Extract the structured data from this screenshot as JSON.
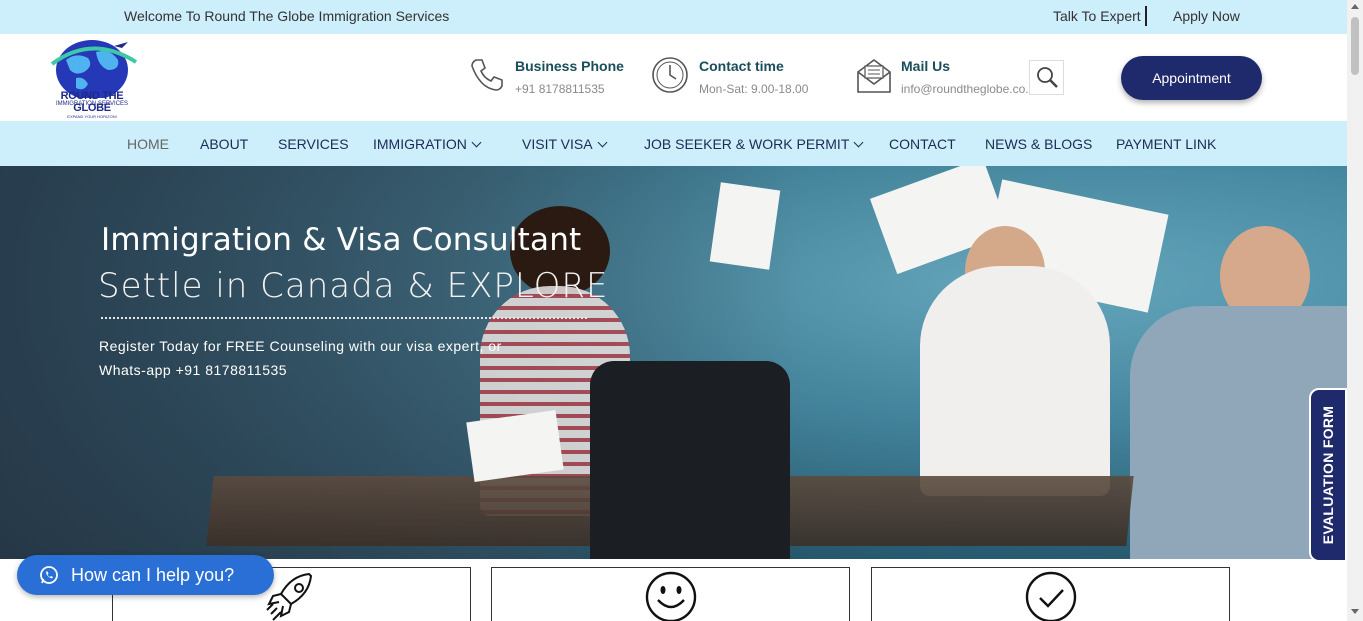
{
  "topbar": {
    "welcome": "Welcome To Round The Globe Immigration Services",
    "talk": "Talk To Expert",
    "apply": "Apply Now"
  },
  "logo": {
    "brand": "ROUND THE GLOBE",
    "sub": "IMMIGRATION SERVICES",
    "tagline": "EXPAND YOUR HORIZON!"
  },
  "header": {
    "phone_title": "Business Phone",
    "phone_value": "+91 8178811535",
    "time_title": "Contact time",
    "time_value": "Mon-Sat: 9.00-18.00",
    "mail_title": "Mail Us",
    "mail_value": "info@roundtheglobe.co.in",
    "appointment": "Appointment"
  },
  "nav": {
    "items": [
      {
        "label": "HOME",
        "dropdown": false
      },
      {
        "label": "ABOUT",
        "dropdown": false
      },
      {
        "label": "SERVICES",
        "dropdown": false
      },
      {
        "label": "IMMIGRATION",
        "dropdown": true
      },
      {
        "label": "VISIT VISA",
        "dropdown": true
      },
      {
        "label": "JOB SEEKER & WORK PERMIT",
        "dropdown": true
      },
      {
        "label": "CONTACT",
        "dropdown": false
      },
      {
        "label": "NEWS & BLOGS",
        "dropdown": false
      },
      {
        "label": "PAYMENT LINK",
        "dropdown": false
      }
    ]
  },
  "hero": {
    "title": "Immigration & Visa Consultant",
    "subtitle": "Settle in Canada & EXPLORE",
    "register": "Register Today for FREE Counseling with our visa expert, or Whats-app +91 8178811535"
  },
  "side_tab": "EVALUATION FORM",
  "whatsapp": {
    "label": "How can I help you?"
  },
  "cards": [
    {
      "icon": "rocket-icon"
    },
    {
      "icon": "smiley-icon"
    },
    {
      "icon": "checkmark-icon"
    }
  ],
  "colors": {
    "accent": "#1e2a6b",
    "light_bar": "#cdeefb",
    "whatsapp": "#2a6fd6"
  }
}
